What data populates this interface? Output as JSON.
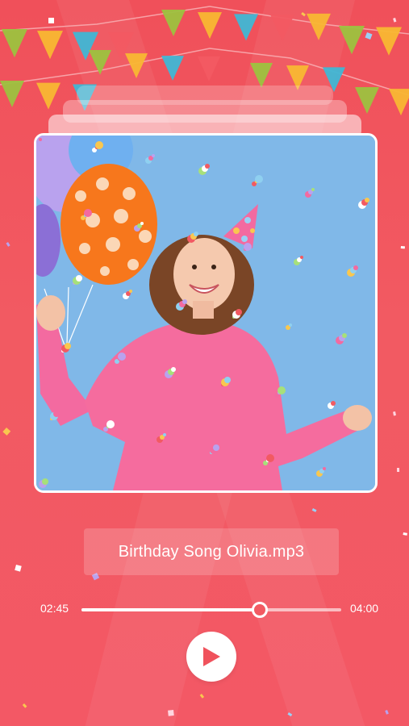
{
  "colors": {
    "background": "#f25a62",
    "accent": "#f0525c",
    "white": "#ffffff",
    "photo_sky": "#7fb6e6"
  },
  "decorations": {
    "bunting_icon": "party-bunting-flags",
    "confetti_icon": "confetti-stars"
  },
  "photo": {
    "subject": "birthday-photo",
    "props": [
      "balloons-icon",
      "party-hat-icon",
      "confetti"
    ]
  },
  "player": {
    "file_name": "Birthday Song Olivia.mp3",
    "current_time": "02:45",
    "total_time": "04:00",
    "progress_fraction": 0.6875,
    "play_icon": "play-icon"
  }
}
